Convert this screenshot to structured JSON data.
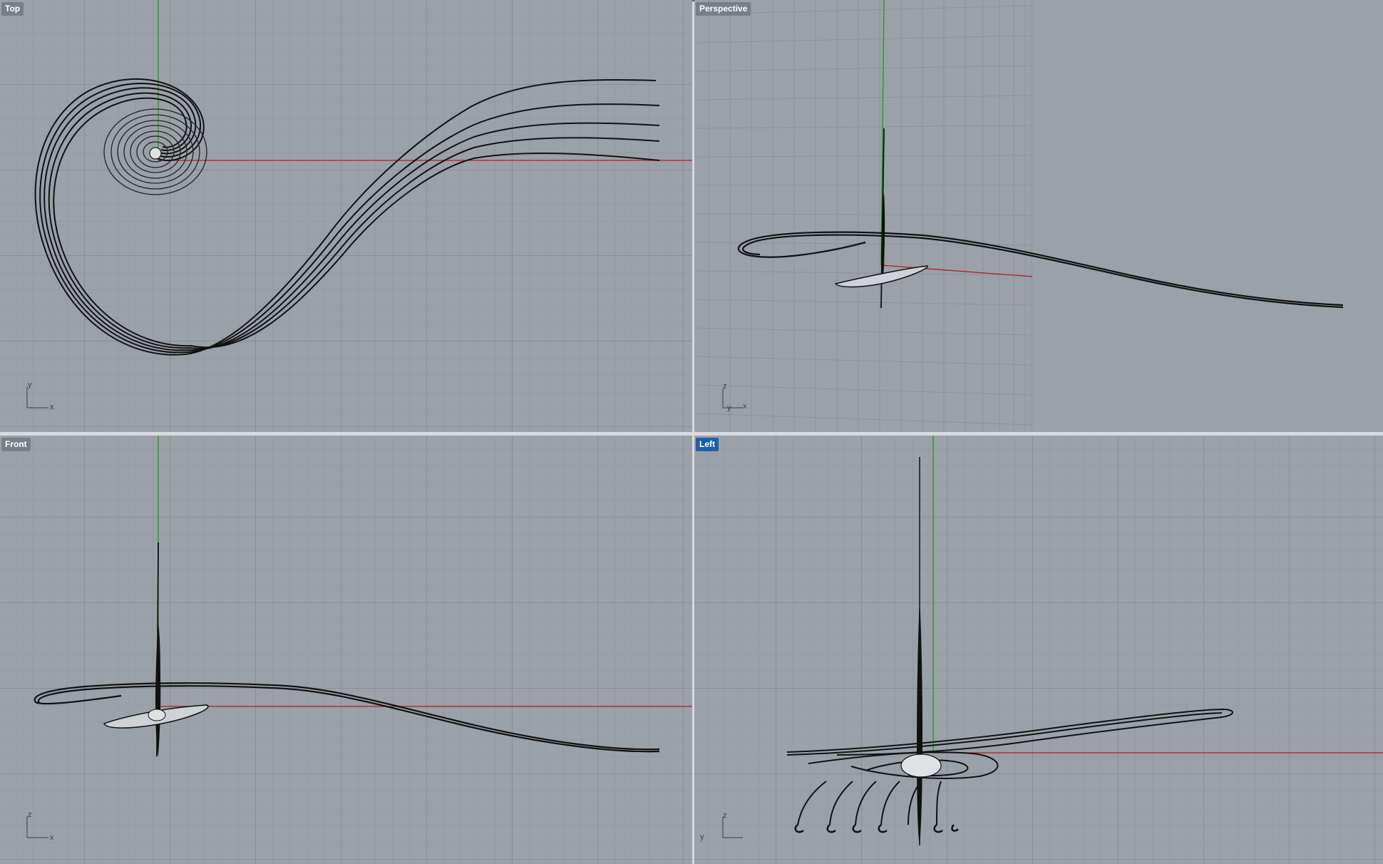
{
  "app": {
    "accent_color": "#1f5fa8",
    "viewport_background": "#9ba1a8",
    "grid_minor_color": "#8f959c",
    "grid_major_color": "#7c8289",
    "x_axis_color": "#b02020",
    "y_axis_color": "#1e9a1e"
  },
  "viewports": {
    "top": {
      "title": "Top",
      "active": false,
      "axis_labels": [
        "y",
        "x"
      ]
    },
    "perspective": {
      "title": "Perspective",
      "active": false,
      "axis_labels": [
        "z",
        "y",
        "x"
      ]
    },
    "front": {
      "title": "Front",
      "active": false,
      "axis_labels": [
        "z",
        "x"
      ]
    },
    "left": {
      "title": "Left",
      "active": true,
      "axis_labels": [
        "z",
        "y"
      ]
    }
  }
}
